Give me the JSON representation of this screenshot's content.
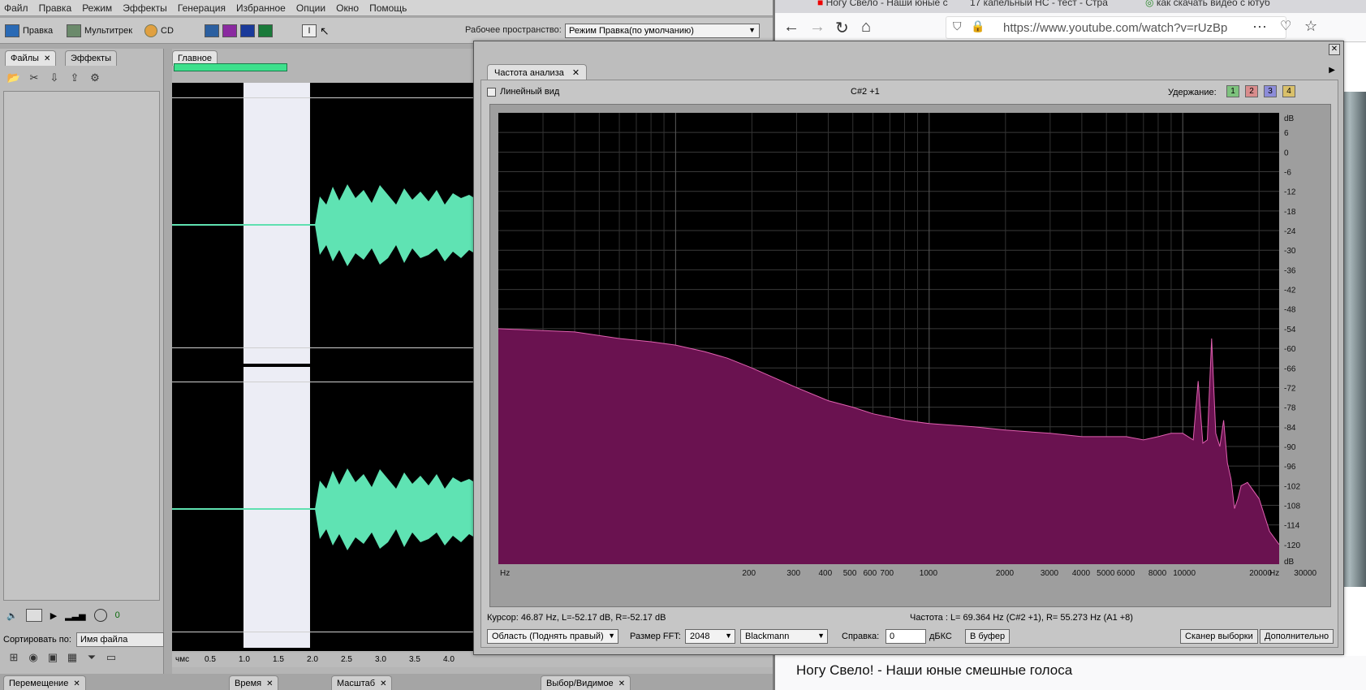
{
  "audition": {
    "menu": [
      "Файл",
      "Правка",
      "Режим",
      "Эффекты",
      "Генерация",
      "Избранное",
      "Опции",
      "Окно",
      "Помощь"
    ],
    "toolbar": {
      "edit": "Правка",
      "multitrack": "Мультитрек",
      "cd": "CD",
      "workspace_label": "Рабочее пространство:",
      "workspace_value": "Режим Правка(по умолчанию)"
    },
    "files_panel": {
      "tab_files": "Файлы",
      "tab_effects": "Эффекты",
      "sort_label": "Сортировать по:",
      "sort_value": "Имя файла",
      "zero": "0"
    },
    "editor": {
      "tab": "Главное",
      "time_labels": [
        "чмс",
        "0.5",
        "1.0",
        "1.5",
        "2.0",
        "2.5",
        "3.0",
        "3.5",
        "4.0"
      ]
    },
    "bottom_tabs": [
      "Перемещение",
      "Время",
      "Масштаб",
      "Выбор/Видимое"
    ]
  },
  "browser": {
    "tabs": [
      "Ногу Свело - Наши юные с",
      "17 капельный НС - тест - Стра",
      "как скачать видео с ютуб"
    ],
    "url": "https://www.youtube.com/watch?v=rUzBp",
    "video_title": "Ногу Свело! - Наши юные смешные голоса"
  },
  "freq_window": {
    "title": "Частота  анализа",
    "linear_view": "Линейный вид",
    "note": "C#2 +1",
    "hold_label": "Удержание:",
    "holds": [
      {
        "label": "1",
        "color": "#7dc27d"
      },
      {
        "label": "2",
        "color": "#d98c8c"
      },
      {
        "label": "3",
        "color": "#8c8cd9"
      },
      {
        "label": "4",
        "color": "#d9c06a"
      }
    ],
    "cursor": "Курсор:    46.87 Hz, L=-52.17 dB, R=-52.17 dB",
    "frequency": "Частота :      L= 69.364 Hz (C#2 +1), R= 55.273 Hz (A1 +8)",
    "area_select": "Область (Поднять правый)",
    "fft_label": "Размер FFT:",
    "fft_value": "2048",
    "window_value": "Blackmann",
    "reference_label": "Справка:",
    "reference_value": "0",
    "dbfs": "дБКС",
    "to_buffer": "В буфер",
    "scan_button": "Сканер выборки",
    "advanced_button": "Дополнительно"
  },
  "chart_data": {
    "type": "area",
    "xscale": "log",
    "xlim": [
      20,
      24000
    ],
    "ylim": [
      -126,
      12
    ],
    "fill_color": "#6a1250",
    "line_color": "#e060b0",
    "x_ticks": [
      "Hz",
      "200",
      "300",
      "400",
      "500",
      "600",
      "700",
      "1000",
      "2000",
      "3000",
      "4000",
      "5000",
      "6000",
      "8000",
      "10000",
      "20000",
      "30000",
      "Hz"
    ],
    "x_tick_values": [
      20,
      200,
      300,
      400,
      500,
      600,
      700,
      1000,
      2000,
      3000,
      4000,
      5000,
      6000,
      8000,
      10000,
      20000,
      30000,
      24000
    ],
    "y_ticks": [
      "dB",
      "6",
      "0",
      "-6",
      "-12",
      "-18",
      "-24",
      "-30",
      "-36",
      "-42",
      "-48",
      "-54",
      "-60",
      "-66",
      "-72",
      "-78",
      "-84",
      "-90",
      "-96",
      "-102",
      "-108",
      "-114",
      "-120",
      "dB"
    ],
    "y_tick_values": [
      12,
      6,
      0,
      -6,
      -12,
      -18,
      -24,
      -30,
      -36,
      -42,
      -48,
      -54,
      -60,
      -66,
      -72,
      -78,
      -84,
      -90,
      -96,
      -102,
      -108,
      -114,
      -120,
      -126
    ],
    "x": [
      20,
      40,
      60,
      80,
      100,
      130,
      160,
      200,
      300,
      400,
      500,
      600,
      800,
      1000,
      1500,
      2000,
      3000,
      4000,
      5000,
      6000,
      7000,
      8000,
      9000,
      10000,
      11000,
      11500,
      12000,
      12500,
      13000,
      13500,
      14000,
      14500,
      15000,
      15500,
      16000,
      16500,
      17000,
      18000,
      20000,
      22000,
      24000
    ],
    "y": [
      -54,
      -55,
      -57,
      -58,
      -59,
      -61,
      -63,
      -66,
      -72,
      -76,
      -78,
      -80,
      -82,
      -83,
      -84,
      -85,
      -86,
      -87,
      -87,
      -87,
      -88,
      -87,
      -86,
      -86,
      -88,
      -70,
      -89,
      -88,
      -57,
      -86,
      -90,
      -82,
      -95,
      -100,
      -109,
      -106,
      -102,
      -101,
      -106,
      -116,
      -120
    ]
  }
}
